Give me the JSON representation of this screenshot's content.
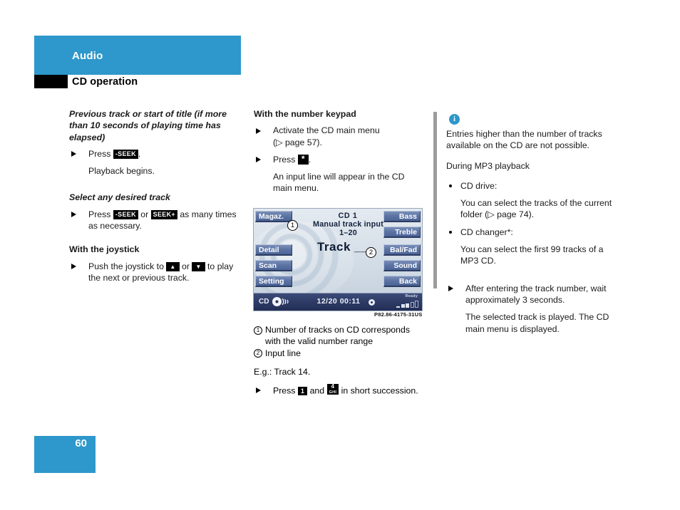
{
  "header": {
    "chapter": "Audio",
    "section": "CD operation"
  },
  "footer": {
    "page_number": "60",
    "accent_color": "#2e97cb"
  },
  "col1": {
    "heading1": "Previous track or start of title (if more than 10 seconds of playing time has elapsed)",
    "step1_pre": "Press",
    "step1_key": "-SEEK",
    "step1_post": ".",
    "step1_result": "Playback begins.",
    "heading2": "Select any desired track",
    "step2_pre": "Press",
    "step2_key_a": "-SEEK",
    "step2_mid": "or",
    "step2_key_b": "SEEK+",
    "step2_post": "as many times as necessary.",
    "heading3": "With the joystick",
    "step3_pre": "Push the joystick to",
    "step3_key_a": "▲",
    "step3_mid": "or",
    "step3_key_b": "▼",
    "step3_post": "to play the next or previous track."
  },
  "col2": {
    "heading": "With the number keypad",
    "step1": "Activate the CD main menu",
    "step1_ref": "(▷ page 57).",
    "step2_pre": "Press",
    "step2_key": "*",
    "step2_post": ".",
    "step2_result": "An input line will appear in the CD main menu.",
    "legend": [
      {
        "num": "1",
        "text": "Number of tracks on CD corresponds with the valid number range"
      },
      {
        "num": "2",
        "text": "Input line"
      }
    ],
    "example": "E.g.: Track 14.",
    "example_step_pre": "Press",
    "example_key_1": "1",
    "example_key_2_digit": "4",
    "example_key_2_letters": "GHI",
    "example_step_mid": "and",
    "example_step_post": "in short succession.",
    "figure_code": "P82.86-4175-31US"
  },
  "screen": {
    "left_buttons": [
      "Magaz.",
      "Detail",
      "Scan",
      "Setting"
    ],
    "right_buttons": [
      "Bass",
      "Treble",
      "Bal/Fad",
      "Sound",
      "Back"
    ],
    "title": "CD 1",
    "subtitle1": "Manual track input",
    "subtitle2": "1–20",
    "track_line": "Track __",
    "marker1": "1",
    "marker2": "2",
    "status_source": "CD",
    "status_track": "12/20",
    "status_time": "00:11",
    "status_ready": "Ready"
  },
  "col3": {
    "note_intro": "Entries higher than the number of tracks available on the CD are not possible.",
    "note_mp3_heading": "During MP3 playback",
    "bullets": [
      {
        "label": "CD drive:",
        "text": "You can select the tracks of the current folder (▷ page 74)."
      },
      {
        "label": "CD changer*:",
        "text": "You can select the first 99 tracks of a MP3 CD."
      }
    ],
    "step_after": "After entering the track number, wait approximately 3 seconds.",
    "step_after_result": "The selected track is played. The CD main menu is displayed."
  }
}
